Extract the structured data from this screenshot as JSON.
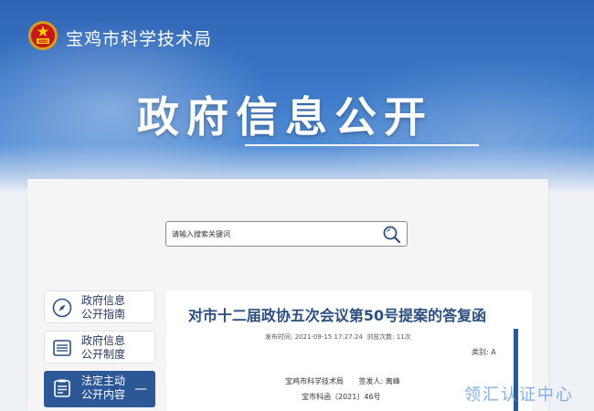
{
  "header": {
    "site_name": "宝鸡市科学技术局",
    "page_heading": "政府信息公开"
  },
  "search": {
    "placeholder": "请输入搜索关键词"
  },
  "sidebar": {
    "items": [
      {
        "label": "政府信息\n公开指南",
        "icon": "compass-icon",
        "active": false
      },
      {
        "label": "政府信息\n公开制度",
        "icon": "list-icon",
        "active": false
      },
      {
        "label": "法定主动\n公开内容",
        "icon": "clipboard-icon",
        "active": true,
        "collapse": "—"
      }
    ]
  },
  "article": {
    "title": "对市十二届政协五次会议第50号提案的答复函",
    "publish_time": "发布时间: 2021-09-15 17:27:24",
    "views": "浏览次数: 11次",
    "category": "类别:  A",
    "issuer": "宝鸡市科学技术局",
    "signer": "签发人: 离峰",
    "doc_number": "宝市科函〔2021〕46号"
  },
  "watermark": "领汇认证中心",
  "colors": {
    "banner_blue": "#2f64b4",
    "accent_blue": "#2c5897",
    "title_blue": "#2c4f82"
  }
}
